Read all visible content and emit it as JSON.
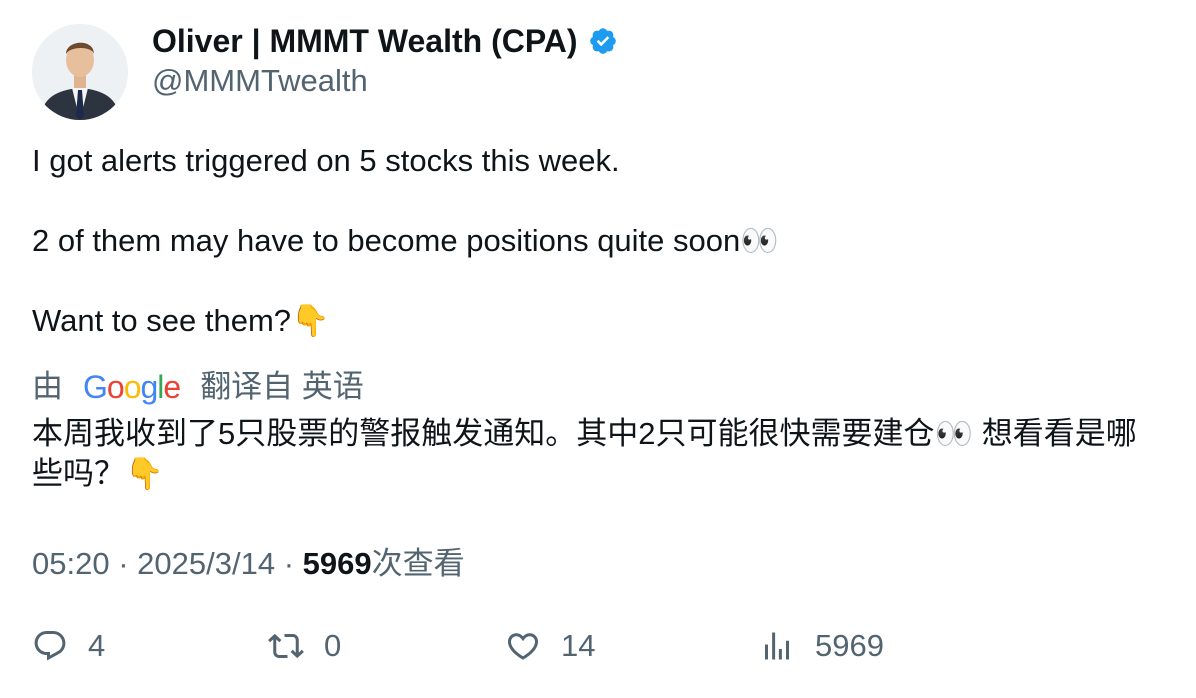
{
  "author": {
    "display_name": "Oliver | MMMT Wealth (CPA)",
    "handle": "@MMMTwealth",
    "verified_icon": "verified-badge-icon",
    "badge_color": "#1d9bf0"
  },
  "tweet": {
    "line1": "I got alerts triggered on 5 stocks this week.",
    "line2": "2 of them may have to become positions quite soon👀",
    "line3": "Want to see them?👇"
  },
  "translation": {
    "by_label": "由",
    "google_letters": [
      "G",
      "o",
      "o",
      "g",
      "l",
      "e"
    ],
    "google_colors": [
      "#4285F4",
      "#EA4335",
      "#FBBC05",
      "#4285F4",
      "#34A853",
      "#EA4335"
    ],
    "from_label": "翻译自 英语",
    "text": "本周我收到了5只股票的警报触发通知。其中2只可能很快需要建仓👀 想看看是哪些吗？👇"
  },
  "meta": {
    "time": "05:20",
    "separator": "·",
    "date": "2025/3/14",
    "views_count": "5969",
    "views_label": "次查看"
  },
  "actions": {
    "reply_count": "4",
    "retweet_count": "0",
    "like_count": "14",
    "views_count": "5969"
  }
}
